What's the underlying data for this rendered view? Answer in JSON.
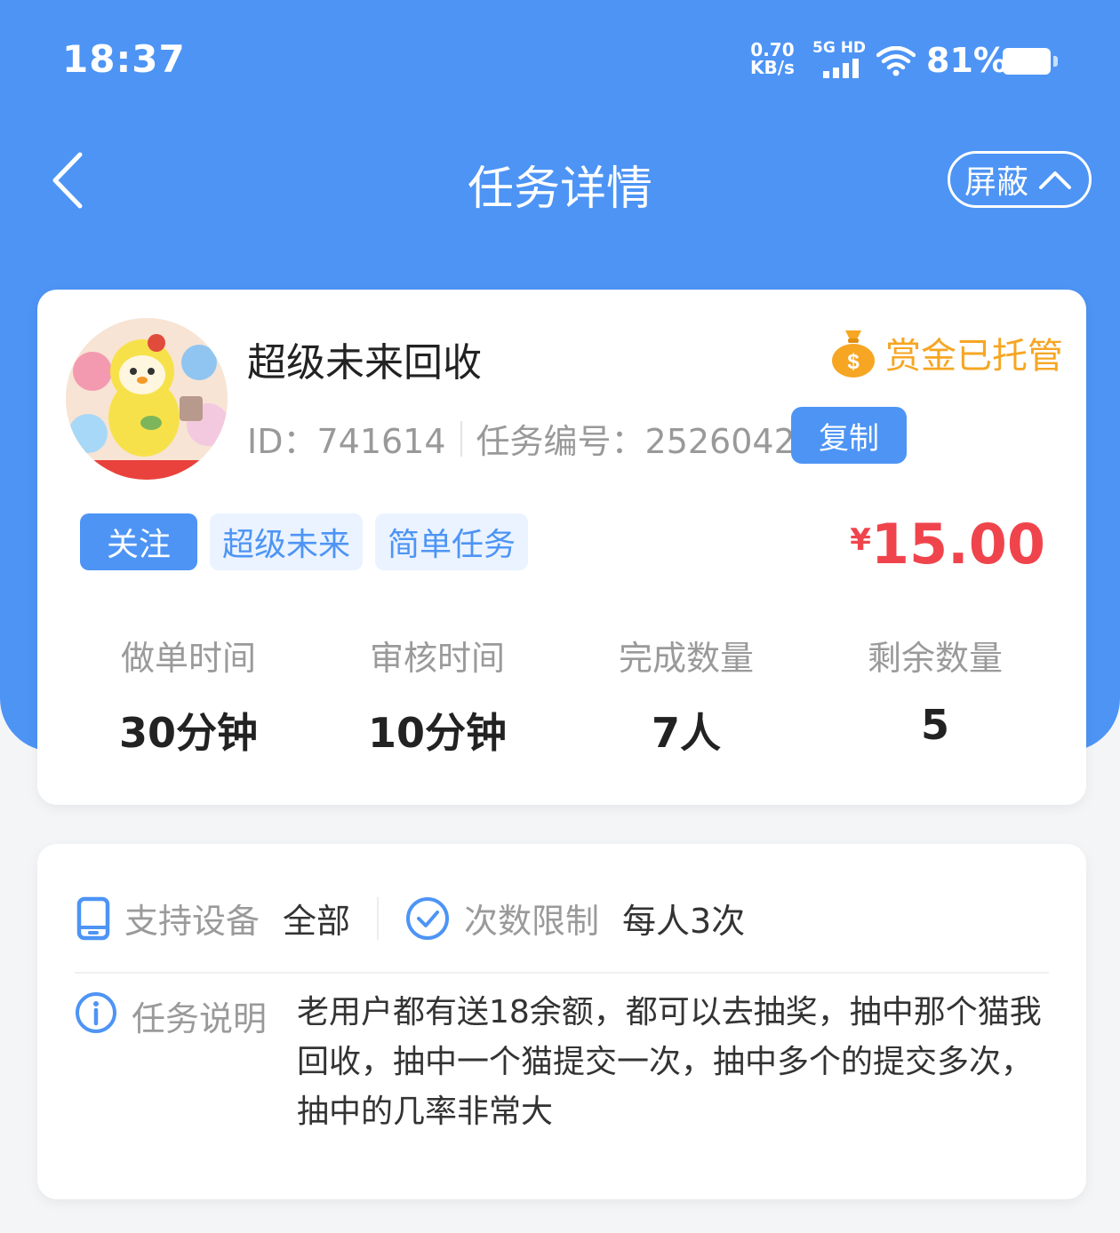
{
  "status_bar": {
    "time": "18:37",
    "net_speed_value": "0.70",
    "net_speed_unit": "KB/s",
    "signal_label": "5G HD",
    "battery": "81%",
    "battery_level": 0.81
  },
  "nav": {
    "title": "任务详情",
    "block_label": "屏蔽"
  },
  "task": {
    "shop_name": "超级未来回收",
    "escrow_label": "赏金已托管",
    "id_text": "ID：741614",
    "task_no_text": "任务编号：25260426",
    "copy_label": "复制",
    "tags": [
      "关注",
      "超级未来",
      "简单任务"
    ],
    "price_currency": "¥",
    "price_value": "15.00",
    "stats": [
      {
        "label": "做单时间",
        "value": "30分钟"
      },
      {
        "label": "审核时间",
        "value": "10分钟"
      },
      {
        "label": "完成数量",
        "value": "7人"
      },
      {
        "label": "剩余数量",
        "value": "5"
      }
    ]
  },
  "details": {
    "device_label": "支持设备",
    "device_value": "全部",
    "limit_label": "次数限制",
    "limit_value": "每人3次",
    "desc_label": "任务说明",
    "desc_text": "老用户都有送18余额，都可以去抽奖，抽中那个猫我回收，抽中一个猫提交一次，抽中多个的提交多次，抽中的几率非常大"
  },
  "colors": {
    "primary": "#4d94f5",
    "price": "#f0444c",
    "escrow": "#f6a623"
  }
}
